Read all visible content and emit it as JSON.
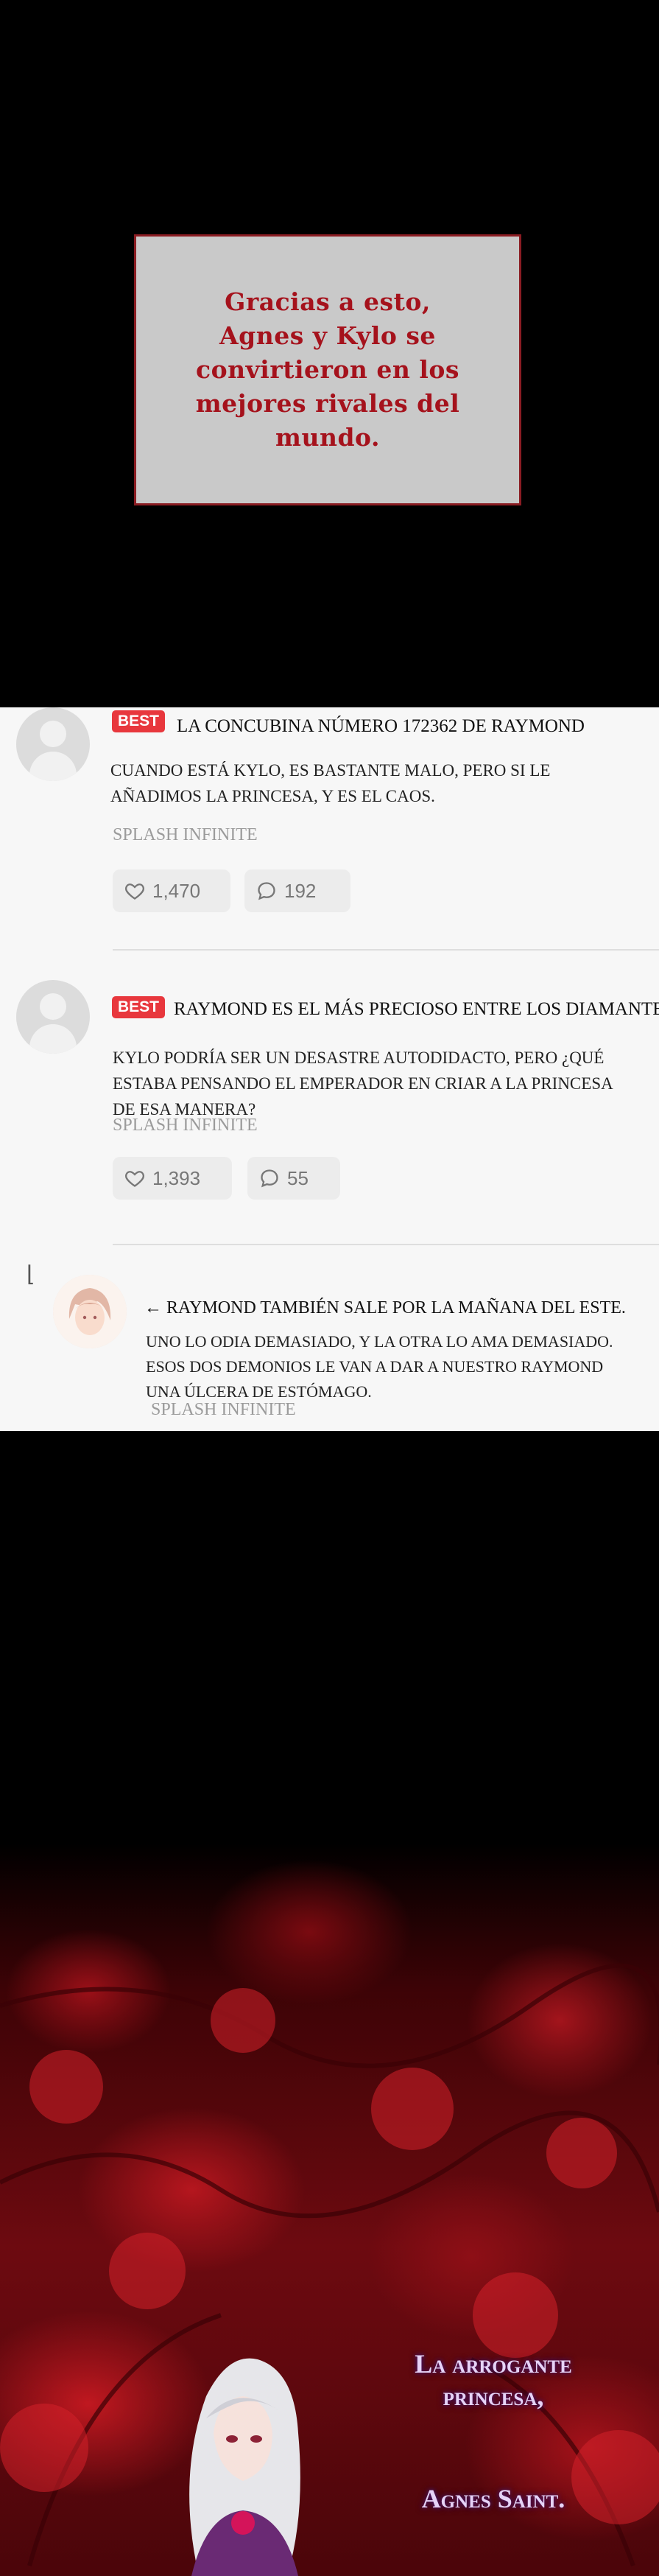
{
  "caption": "Gracias a esto, Agnes y Kylo se convirtieron en los mejores rivales del mundo.",
  "comments": [
    {
      "badge": "BEST",
      "title": "LA CONCUBINA NÚMERO 172362 DE RAYMOND",
      "body": "CUANDO ESTÁ KYLO, ES BASTANTE MALO, PERO SI LE AÑADIMOS LA PRINCESA, Y ES EL CAOS.",
      "author": "SPLASH INFINITE",
      "likes": "1,470",
      "replies": "192"
    },
    {
      "badge": "BEST",
      "title": "RAYMOND ES EL MÁS PRECIOSO ENTRE LOS DIAMANTES",
      "body": "KYLO PODRÍA SER UN DESASTRE AUTODIDACTO, PERO ¿QUÉ ESTABA PENSANDO EL EMPERADOR EN CRIAR A LA PRINCESA DE ESA MANERA?",
      "author": "SPLASH INFINITE",
      "likes": "1,393",
      "replies": "55"
    }
  ],
  "reply": {
    "title": "← RAYMOND TAMBIÉN SALE POR LA MAÑANA DEL ESTE.",
    "body": "UNO LO ODIA DEMASIADO, Y LA OTRA LO AMA DEMASIADO. ESOS DOS DEMONIOS LE VAN A DAR A NUESTRO RAYMOND UNA ÚLCERA DE ESTÓMAGO.",
    "author": "SPLASH INFINITE"
  },
  "title_card": {
    "line1": "La arrogante princesa,",
    "line2": "Agnes Saint."
  },
  "colors": {
    "caption_text": "#a5121c",
    "caption_border": "#8a1c22",
    "best_badge": "#e8373d",
    "title_card_text": "#e6d3f7"
  }
}
